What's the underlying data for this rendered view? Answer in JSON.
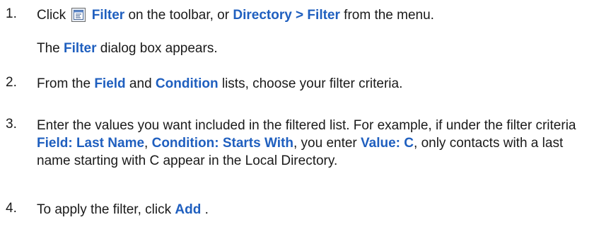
{
  "steps": [
    {
      "number": "1.",
      "line1": {
        "t1": "Click",
        "icon": "filter-toolbar-icon",
        "k1": "Filter",
        "t2": " on the toolbar, or ",
        "k2": "Directory > Filter",
        "t3": " from the menu."
      },
      "line2": {
        "t1": "The ",
        "k1": "Filter",
        "t2": " dialog box appears."
      }
    },
    {
      "number": "2.",
      "t1": "From the ",
      "k1": "Field",
      "t2": " and ",
      "k2": "Condition",
      "t3": " lists, choose your filter criteria."
    },
    {
      "number": "3.",
      "t1": "Enter the values you want included in the filtered list. For example, if under the filter criteria ",
      "k1": "Field: Last Name",
      "t2": ", ",
      "k2": "Condition: Starts With",
      "t3": ", you enter ",
      "k3": "Value: C",
      "t4": ", only contacts with a last name starting with C appear in the Local Directory."
    },
    {
      "number": "4.",
      "t1": "To apply the filter, click ",
      "k1": "Add",
      "t2": " ."
    }
  ],
  "colors": {
    "keyword": "#1f5fbf",
    "text": "#1a1a1a"
  }
}
